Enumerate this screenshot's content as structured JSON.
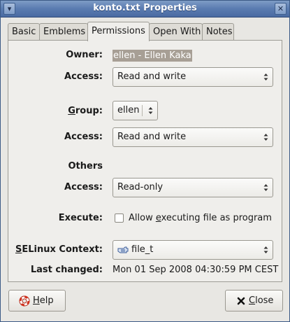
{
  "window": {
    "title": "konto.txt Properties"
  },
  "tabs": [
    {
      "label": "Basic"
    },
    {
      "label": "Emblems"
    },
    {
      "label": "Permissions"
    },
    {
      "label": "Open With"
    },
    {
      "label": "Notes"
    }
  ],
  "owner": {
    "label": "Owner:",
    "value": "ellen - Ellen Kaka"
  },
  "owner_access": {
    "label": "Access:",
    "value": "Read and write"
  },
  "group": {
    "label_mnemonic": "G",
    "label_rest": "roup:",
    "value": "ellen"
  },
  "group_access": {
    "label": "Access:",
    "value": "Read and write"
  },
  "others": {
    "heading": "Others",
    "access_label": "Access:",
    "access_value": "Read-only"
  },
  "execute": {
    "label": "Execute:",
    "checkbox_pre": "Allow ",
    "checkbox_mnemonic": "e",
    "checkbox_post": "xecuting file as program",
    "checked": false
  },
  "selinux": {
    "label_mnemonic": "S",
    "label_rest": "ELinux Context:",
    "value": "file_t"
  },
  "last_changed": {
    "label": "Last changed:",
    "value": "Mon 01 Sep 2008 04:30:59 PM CEST"
  },
  "buttons": {
    "help_mnemonic": "H",
    "help_rest": "elp",
    "close_mnemonic": "C",
    "close_rest": "lose"
  },
  "icons": {
    "help": "lifebuoy-help-icon",
    "close": "x-close-icon",
    "selinux": "hand-pointer-icon"
  }
}
